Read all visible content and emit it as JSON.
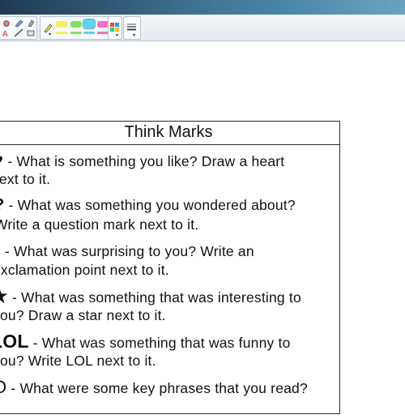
{
  "toolbar": {
    "colors": {
      "yellow": "#f2ef5c",
      "green": "#7fe25b",
      "cyan": "#5fd4f0",
      "pink": "#f06fc8",
      "accent": "#6fa3d2"
    }
  },
  "card": {
    "title": "Think Marks",
    "items": [
      {
        "symbol": "♥",
        "line1": " - What is something you like? Draw a heart",
        "line2": "next to it."
      },
      {
        "symbol": "?",
        "line1": " - What was something you wondered about?",
        "line2": "Write a question mark next to it."
      },
      {
        "symbol": "!",
        "line1": " - What was surprising to you? Write an",
        "line2": "exclamation point next to it."
      },
      {
        "symbol": "★",
        "line1": " - What was something that was interesting to",
        "line2": "you? Draw a star next to it."
      },
      {
        "symbol": "LOL",
        "line1": " - What was something that was funny to",
        "line2": "you? Write LOL next to it."
      },
      {
        "symbol": "O",
        "line1": " - What were some key phrases that you read?",
        "line2": ""
      }
    ]
  }
}
